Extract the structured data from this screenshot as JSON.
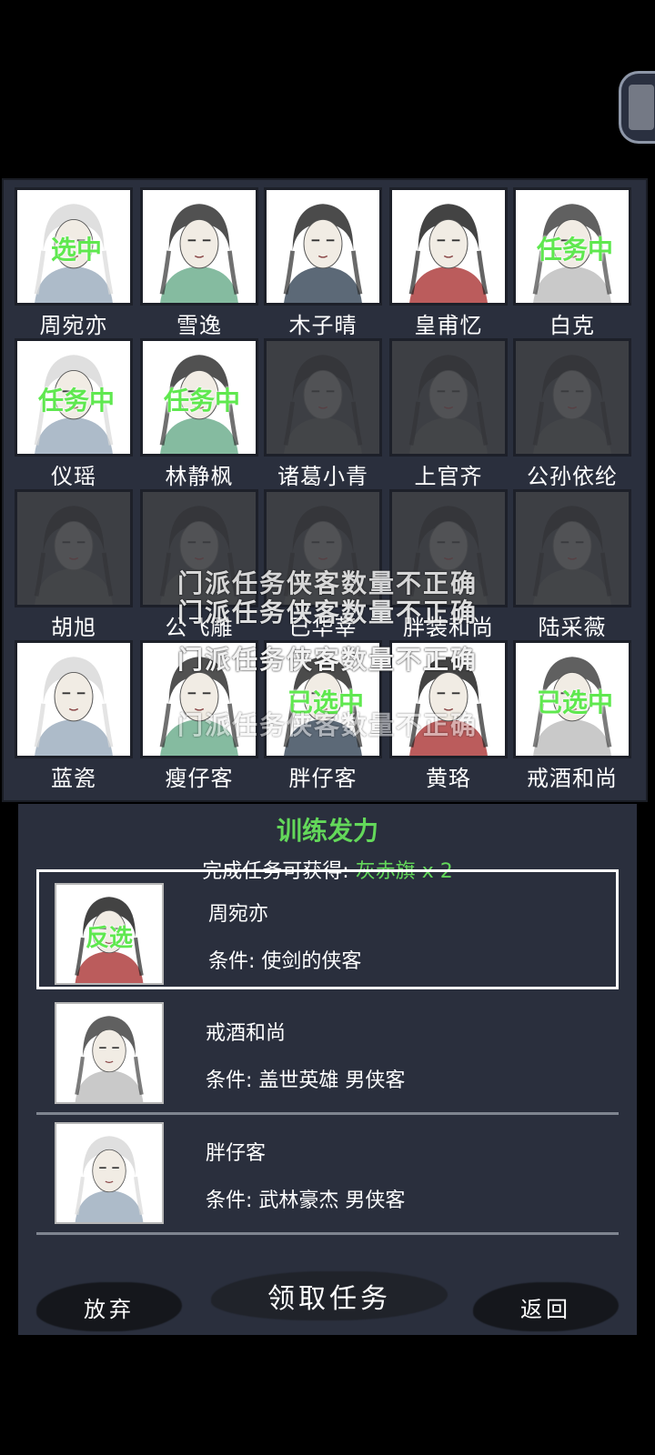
{
  "colors": {
    "badge_green": "#5fe84f",
    "panel_bg": "#2a2f3d",
    "title_green": "#63d85a"
  },
  "heroes": [
    {
      "name": "周宛亦",
      "badge": "选中",
      "locked": false
    },
    {
      "name": "雪逸",
      "badge": "",
      "locked": false
    },
    {
      "name": "木子晴",
      "badge": "",
      "locked": false
    },
    {
      "name": "皇甫忆",
      "badge": "",
      "locked": false
    },
    {
      "name": "白克",
      "badge": "任务中",
      "locked": false
    },
    {
      "name": "仪瑶",
      "badge": "任务中",
      "locked": false
    },
    {
      "name": "林静枫",
      "badge": "任务中",
      "locked": false
    },
    {
      "name": "诸葛小青",
      "badge": "",
      "locked": true
    },
    {
      "name": "上官齐",
      "badge": "",
      "locked": true
    },
    {
      "name": "公孙依纶",
      "badge": "",
      "locked": true
    },
    {
      "name": "胡旭",
      "badge": "",
      "locked": true
    },
    {
      "name": "公飞雕",
      "badge": "",
      "locked": true
    },
    {
      "name": "已华莘",
      "badge": "",
      "locked": true
    },
    {
      "name": "胖装和尚",
      "badge": "",
      "locked": true
    },
    {
      "name": "陆采薇",
      "badge": "",
      "locked": true
    },
    {
      "name": "蓝瓷",
      "badge": "",
      "locked": false
    },
    {
      "name": "瘦仔客",
      "badge": "",
      "locked": false
    },
    {
      "name": "胖仔客",
      "badge": "已选中",
      "locked": false
    },
    {
      "name": "黄珞",
      "badge": "",
      "locked": false
    },
    {
      "name": "戒酒和尚",
      "badge": "已选中",
      "locked": false
    }
  ],
  "toasts": [
    "门派任务侠客数量不正确",
    "门派任务侠客数量不正确",
    "门派任务侠客数量不正确",
    "门派任务侠客数量不正确"
  ],
  "task": {
    "title": "训练发力",
    "reward_label": "完成任务可获得:",
    "reward_item": "灰赤旗",
    "reward_count": "x 2",
    "requirements": [
      {
        "name": "周宛亦",
        "condition": "条件:  使剑的侠客",
        "badge": "反选",
        "selected": true
      },
      {
        "name": "戒酒和尚",
        "condition": "条件:  盖世英雄  男侠客",
        "badge": "",
        "selected": false
      },
      {
        "name": "胖仔客",
        "condition": "条件:  武林豪杰  男侠客",
        "badge": "",
        "selected": false
      }
    ]
  },
  "buttons": {
    "abandon": "放弃",
    "accept": "领取任务",
    "back": "返回"
  }
}
